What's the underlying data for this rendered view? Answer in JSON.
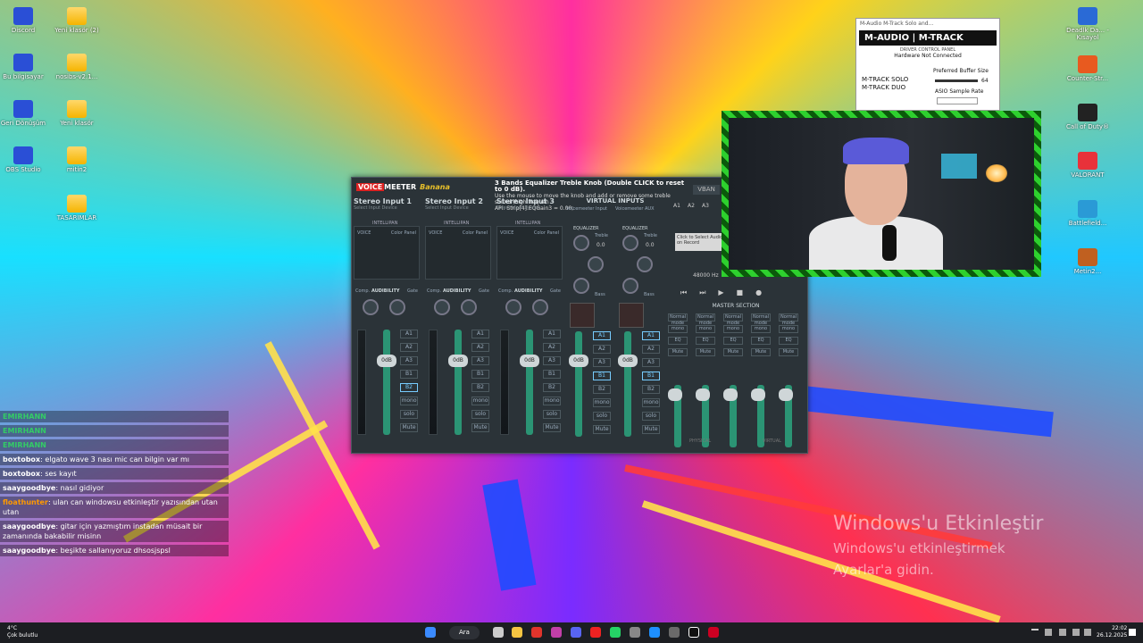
{
  "desktop_left": [
    {
      "label": "Discord",
      "kind": "app"
    },
    {
      "label": "Bu bilgisayar",
      "kind": "app"
    },
    {
      "label": "Geri Dönüşüm",
      "kind": "app"
    },
    {
      "label": "OBS Studio",
      "kind": "app"
    },
    {
      "label": "Yeni klasör (2)",
      "kind": "folder"
    },
    {
      "label": "nosibs-v2.1...",
      "kind": "folder"
    },
    {
      "label": "Yeni klasör",
      "kind": "folder"
    },
    {
      "label": "mitin2",
      "kind": "folder"
    },
    {
      "label": "TASARIMLAR",
      "kind": "folder"
    }
  ],
  "desktop_right": [
    {
      "label": "Deadlk Da... - Kısayol"
    },
    {
      "label": "Counter-Str..."
    },
    {
      "label": "Call of Duty®"
    },
    {
      "label": "VALORANT"
    },
    {
      "label": "Battlefield..."
    },
    {
      "label": "Metin2..."
    }
  ],
  "voicemeeter": {
    "logo_voice": "VOICE",
    "logo_meeter": "MEETER",
    "logo_banana": "Banana",
    "info_title": "3 Bands Equalizer Treble Knob (Double CLICK to reset to 0 dB).",
    "info_line1": "Use the mouse to move the knob and add or remove some treble sound (high frequen",
    "info_line2": "API: Strip[4].EQGain3 = 0.00;",
    "vban": "VBAN",
    "strips": [
      {
        "title": "Stereo Input 1",
        "sub": "Select Input Device",
        "gain": "0dB"
      },
      {
        "title": "Stereo Input 2",
        "sub": "Select Input Device",
        "gain": "0dB"
      },
      {
        "title": "Stereo Input 3",
        "sub": "Select Input Device",
        "gain": "0dB"
      }
    ],
    "intellipan": "INTELLIPAN",
    "voice": "VOICE",
    "color_panel": "Color Panel",
    "audibility": "AUDIBILITY",
    "comp": "Comp.",
    "gate": "Gate",
    "fader_gain": "Fader Gain",
    "bus_labels": [
      "A1",
      "A2",
      "A3",
      "B1",
      "B2",
      "mono",
      "solo",
      "Mute"
    ],
    "virtual_inputs": "VIRTUAL INPUTS",
    "virtual": [
      {
        "title": "Voicemeeter Input",
        "gain": "0dB",
        "eq_label": "EQUALIZER"
      },
      {
        "title": "Voicemeeter AUX",
        "gain": "0dB",
        "eq_label": "EQUALIZER"
      }
    ],
    "treble": "Treble",
    "bass": "Bass",
    "eq_value": "0.0",
    "master_section": "MASTER SECTION",
    "master_buttons": [
      "Normal mode",
      "mono",
      "EQ",
      "Mute"
    ],
    "hw_outputs": [
      "A1",
      "A2",
      "A3"
    ],
    "recorder_hint": "Click to Select Audio or click on Record",
    "sample_rate": "48000 Hz",
    "physical": "PHYSICAL",
    "virtual_label": "VIRTUAL"
  },
  "mtrack": {
    "window_title": "M-Audio M-Track Solo and...",
    "brand": "M-AUDIO | M-TRACK",
    "panel": "DRIVER CONTROL PANEL",
    "status": "Hardware Not Connected",
    "model1": "M-TRACK SOLO",
    "model2": "M-TRACK DUO",
    "pref_buffer": "Preferred Buffer Size",
    "buffer_value": "64",
    "asio_rate": "ASIO Sample Rate"
  },
  "chat": [
    {
      "user": "EMIRHANN",
      "msg": "",
      "color": "#3c6"
    },
    {
      "user": "EMIRHANN",
      "msg": "",
      "color": "#3c6"
    },
    {
      "user": "EMIRHANN",
      "msg": "",
      "color": "#3c6"
    },
    {
      "user": "boxtobox",
      "msg": ": elgato wave 3 nası mic can bilgin var mı",
      "color": "#fff"
    },
    {
      "user": "boxtobox",
      "msg": ": ses kayıt",
      "color": "#fff"
    },
    {
      "user": "saaygoodbye",
      "msg": ": nasıl gidiyor",
      "color": "#fff"
    },
    {
      "user": "floathunter",
      "msg": ": ulan can windowsu etkinleştir yazısından utan utan",
      "color": "#f90"
    },
    {
      "user": "saaygoodbye",
      "msg": ": gitar için yazmıştım instadan müsait bir zamanında bakabilir misinn",
      "color": "#fff"
    },
    {
      "user": "saaygoodbye",
      "msg": ": beşikte sallanıyoruz dhsosjspsl",
      "color": "#fff"
    }
  ],
  "watermark": {
    "line1": "Windows'u Etkinleştir",
    "line2": "Windows'u etkinleştirmek",
    "line3": "Ayarlar'a gidin."
  },
  "taskbar": {
    "temp": "4°C",
    "weather": "Çok bulutlu",
    "search": "Ara",
    "time": "22:02",
    "date": "26.12.2025"
  }
}
